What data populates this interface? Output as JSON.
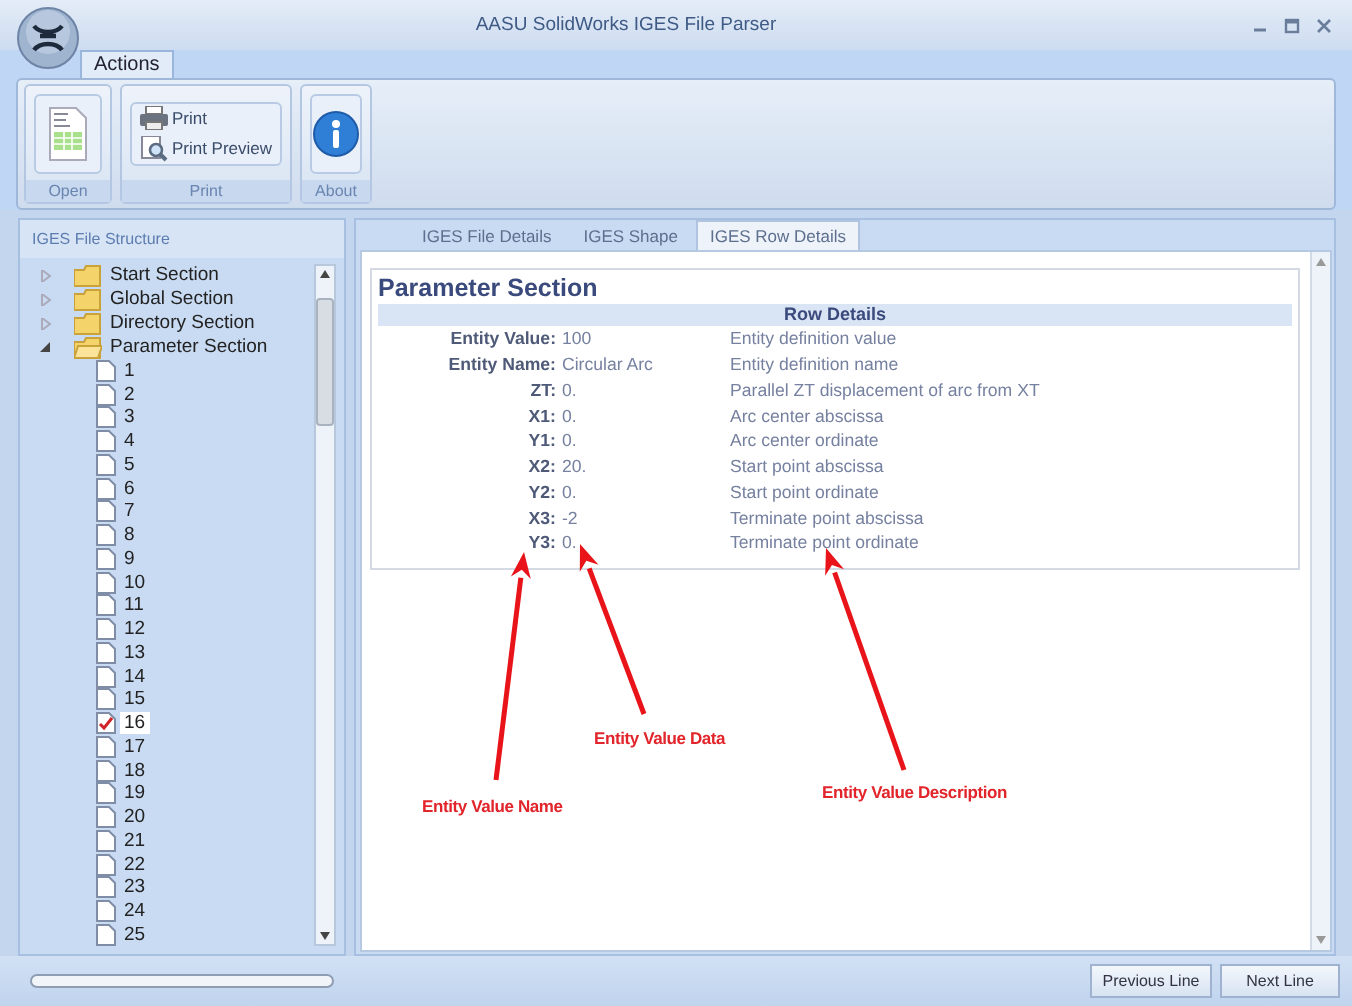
{
  "window": {
    "title": "AASU SolidWorks IGES File Parser"
  },
  "ribbon": {
    "tabs": [
      {
        "label": "Actions",
        "selected": true
      }
    ],
    "groups": [
      {
        "label": "Open"
      },
      {
        "label": "Print",
        "items": [
          {
            "label": "Print"
          },
          {
            "label": "Print Preview"
          }
        ]
      },
      {
        "label": "About"
      }
    ]
  },
  "tree": {
    "title": "IGES File Structure",
    "items": [
      {
        "label": "Start Section",
        "expanded": false,
        "selected": false
      },
      {
        "label": "Global Section",
        "expanded": false,
        "selected": false
      },
      {
        "label": "Directory Section",
        "expanded": false,
        "selected": false
      },
      {
        "label": "Parameter Section",
        "expanded": true,
        "selected": false,
        "children": [
          {
            "label": "1",
            "selected": false
          },
          {
            "label": "2",
            "selected": false
          },
          {
            "label": "3",
            "selected": false
          },
          {
            "label": "4",
            "selected": false
          },
          {
            "label": "5",
            "selected": false
          },
          {
            "label": "6",
            "selected": false
          },
          {
            "label": "7",
            "selected": false
          },
          {
            "label": "8",
            "selected": false
          },
          {
            "label": "9",
            "selected": false
          },
          {
            "label": "10",
            "selected": false
          },
          {
            "label": "11",
            "selected": false
          },
          {
            "label": "12",
            "selected": false
          },
          {
            "label": "13",
            "selected": false
          },
          {
            "label": "14",
            "selected": false
          },
          {
            "label": "15",
            "selected": false
          },
          {
            "label": "16",
            "selected": true
          },
          {
            "label": "17",
            "selected": false
          },
          {
            "label": "18",
            "selected": false
          },
          {
            "label": "19",
            "selected": false
          },
          {
            "label": "20",
            "selected": false
          },
          {
            "label": "21",
            "selected": false
          },
          {
            "label": "22",
            "selected": false
          },
          {
            "label": "23",
            "selected": false
          },
          {
            "label": "24",
            "selected": false
          },
          {
            "label": "25",
            "selected": false
          }
        ]
      }
    ]
  },
  "tabs": [
    {
      "label": "IGES File Details",
      "selected": false
    },
    {
      "label": "IGES Shape",
      "selected": false
    },
    {
      "label": "IGES Row Details",
      "selected": true
    }
  ],
  "details": {
    "heading": "Parameter Section",
    "table_title": "Row Details",
    "rows": [
      {
        "name": "Entity Value:",
        "value": "100",
        "description": "Entity definition value"
      },
      {
        "name": "Entity Name:",
        "value": "Circular Arc",
        "description": "Entity definition name"
      },
      {
        "name": "ZT:",
        "value": "0.",
        "description": "Parallel ZT displacement of arc from XT"
      },
      {
        "name": "X1:",
        "value": "0.",
        "description": "Arc center abscissa"
      },
      {
        "name": "Y1:",
        "value": "0.",
        "description": "Arc center ordinate"
      },
      {
        "name": "X2:",
        "value": "20.",
        "description": "Start point abscissa"
      },
      {
        "name": "Y2:",
        "value": "0.",
        "description": "Start point ordinate"
      },
      {
        "name": "X3:",
        "value": "-2",
        "description": "Terminate point abscissa"
      },
      {
        "name": "Y3:",
        "value": "0.",
        "description": "Terminate point ordinate"
      }
    ]
  },
  "annotations": [
    "Entity Value Name",
    "Entity Value Data",
    "Entity Value Description"
  ],
  "footer": {
    "progress": {
      "level": 0
    },
    "buttons": [
      "Previous Line",
      "Next Line"
    ]
  }
}
